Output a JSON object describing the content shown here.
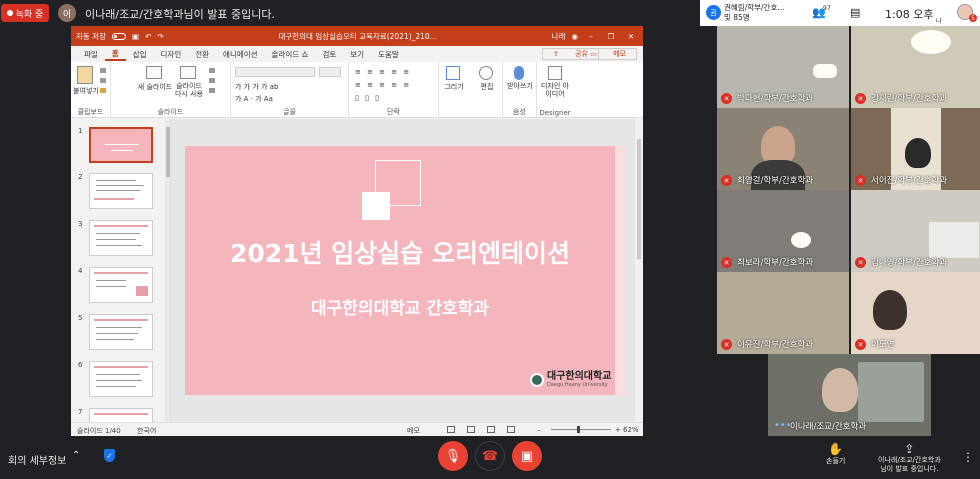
{
  "topbar": {
    "record_label": "녹화 중",
    "presenter_initial": "이",
    "presenter_text": "이나래/조교/간호학과님이 발표 중입니다."
  },
  "ppt": {
    "autosave": "자동 저장",
    "doc_title": "대구한의대 임상실습오티 교육자료(2021)_210...",
    "user": "나래",
    "tabs": [
      "파일",
      "홈",
      "삽입",
      "디자인",
      "전환",
      "애니메이션",
      "슬라이드 쇼",
      "검토",
      "보기",
      "도움말"
    ],
    "active_tab": "홈",
    "share": "공유",
    "memo": "메모",
    "ribbon": {
      "paste": "붙여넣기",
      "new_slide": "새 슬라이드",
      "reuse_slide": "슬라이드 다시 사용",
      "draw": "그리기",
      "edit": "편집",
      "dictate": "받아쓰기",
      "design_ideas": "디자인 아이디어",
      "groups": [
        "클립보드",
        "슬라이드",
        "글꼴",
        "단락",
        "음성",
        "Designer"
      ]
    },
    "thumbnails": [
      "1",
      "2",
      "3",
      "4",
      "5",
      "6",
      "7"
    ],
    "slide": {
      "title": "2021년 임상실습 오리엔테이션",
      "subtitle": "대구한의대학교 간호학과",
      "logo_text": "대구한의대학교",
      "logo_sub": "Daegu Haany University"
    },
    "status": {
      "slide_count": "슬라이드 1/40",
      "language": "한국어",
      "notes": "메모",
      "zoom": "62%"
    }
  },
  "sysbar": {
    "host_initial": "권",
    "host_line1": "권혜림/학부/간호...",
    "host_line2": "및 85명",
    "participants_count": "97",
    "time": "1:08 오후",
    "user_label": "나",
    "badge": "5"
  },
  "participants": [
    {
      "name": "박다현/학부/간호학과"
    },
    {
      "name": "김재린/학부/간호학과"
    },
    {
      "name": "최영걸/학부/간호학과"
    },
    {
      "name": "서이진/학부/간호학과"
    },
    {
      "name": "최보라/학부/간호학과"
    },
    {
      "name": "김나영/학부/간호학과"
    },
    {
      "name": "이유진/학부/간호학과"
    },
    {
      "name": "이도연"
    },
    {
      "name": "이나래/조교/간호학과"
    }
  ],
  "bottombar": {
    "meeting_info": "회의 세부정보",
    "raise_hand": "손들기",
    "presenting_line1": "이나래/조교/간호학과",
    "presenting_line2": "님이 발표 중입니다."
  },
  "colors": {
    "ppt_accent": "#c43e1c",
    "slide_bg": "#f4b5bd",
    "meet_red": "#ea4335",
    "meet_bg": "#202124"
  }
}
